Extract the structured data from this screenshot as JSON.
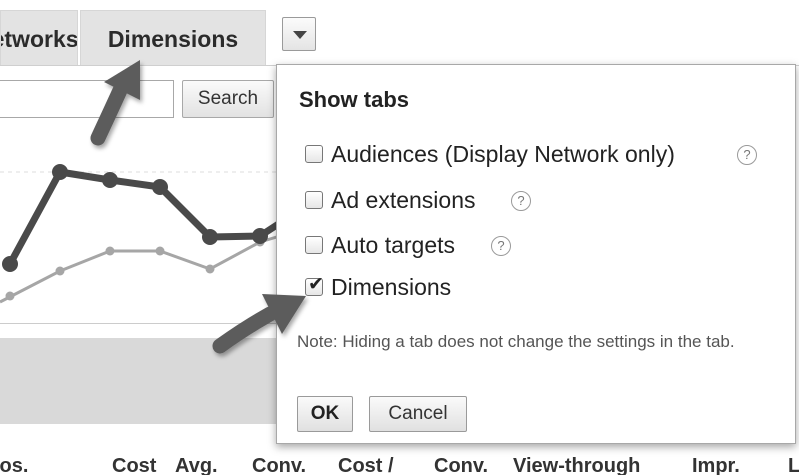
{
  "tabs": {
    "networks_label": "Networks",
    "dimensions_label": "Dimensions"
  },
  "search": {
    "value": "",
    "button_label": "Search"
  },
  "popup": {
    "title": "Show tabs",
    "options": [
      {
        "label": "Audiences (Display Network only)",
        "checked": false,
        "help": "?"
      },
      {
        "label": "Ad extensions",
        "checked": false,
        "help": "?"
      },
      {
        "label": "Auto targets",
        "checked": false,
        "help": "?"
      },
      {
        "label": "Dimensions",
        "checked": true
      }
    ],
    "check_mark": "✔",
    "note": "Note: Hiding a tab does not change the settings in the tab.",
    "ok_label": "OK",
    "cancel_label": "Cancel"
  },
  "table": {
    "columns": [
      "Avg. Pos.",
      "Cost",
      "Avg.",
      "Conv.",
      "Cost /",
      "Conv.",
      "View-through",
      "Impr.",
      "L"
    ]
  },
  "colors": {
    "primary_line": "#4a4a4a",
    "secondary_line": "#a6a6a6",
    "arrow": "#5c5c5c"
  },
  "icons": {
    "tab_menu": "chevron-down-icon",
    "help": "help-circle-icon",
    "arrow": "pointer-arrow-icon"
  }
}
